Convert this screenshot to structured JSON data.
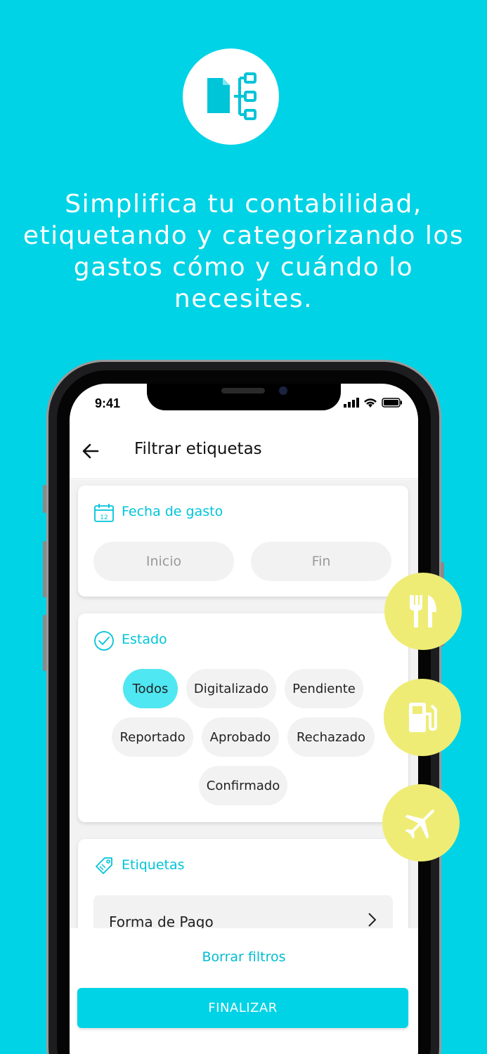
{
  "headline": "Simplifica tu contabilidad, etiquetando y categorizando los gastos cómo y cuándo lo necesites.",
  "hero_icon": "document-hierarchy-icon",
  "status_bar": {
    "time": "9:41"
  },
  "header": {
    "title": "Filtrar etiquetas",
    "back_icon": "arrow-left-icon"
  },
  "date_section": {
    "title": "Fecha de gasto",
    "icon": "calendar-icon",
    "start_placeholder": "Inicio",
    "end_placeholder": "Fin"
  },
  "status_section": {
    "title": "Estado",
    "icon": "check-circle-icon",
    "chips": [
      {
        "label": "Todos",
        "active": true
      },
      {
        "label": "Digitalizado",
        "active": false
      },
      {
        "label": "Pendiente",
        "active": false
      },
      {
        "label": "Reportado",
        "active": false
      },
      {
        "label": "Aprobado",
        "active": false
      },
      {
        "label": "Rechazado",
        "active": false
      },
      {
        "label": "Confirmado",
        "active": false
      }
    ]
  },
  "tags_section": {
    "title": "Etiquetas",
    "icon": "tag-icon",
    "items": [
      {
        "label": "Forma de Pago"
      }
    ]
  },
  "footer": {
    "clear_label": "Borrar filtros",
    "finish_label": "FINALIZAR"
  },
  "floating_icons": [
    "restaurant-icon",
    "fuel-icon",
    "airplane-icon"
  ],
  "colors": {
    "accent": "#00D3E6",
    "chip_active": "#4FE7F2",
    "badge": "#EEEC75"
  }
}
